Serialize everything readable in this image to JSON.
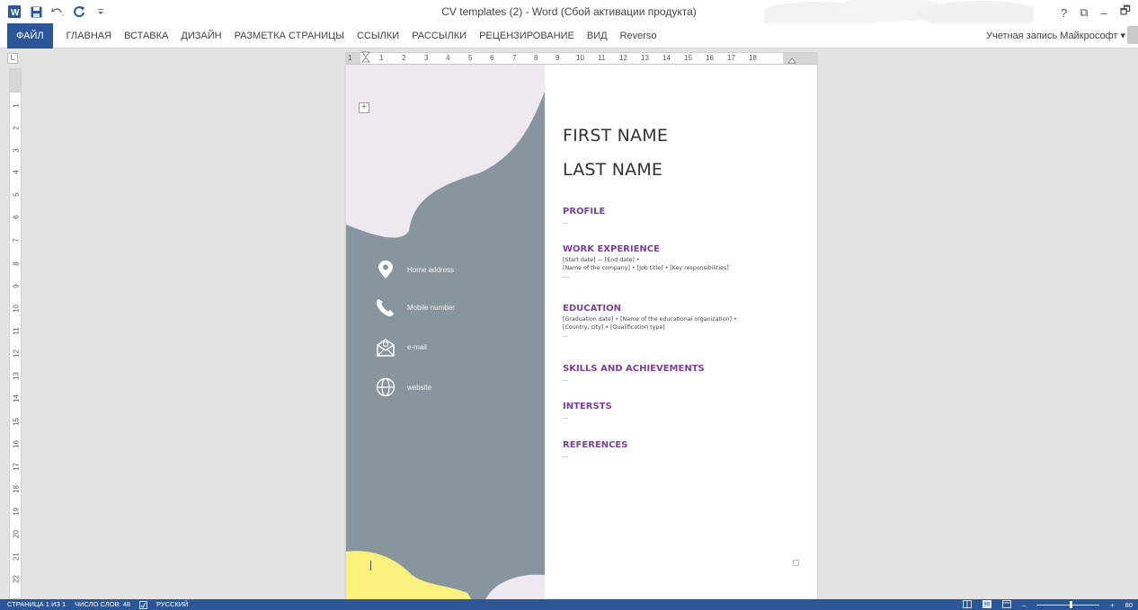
{
  "titlebar": {
    "title": "CV templates (2) - Word (Сбой активации продукта)",
    "help": "?",
    "restore": "⧉",
    "minimize": "–",
    "maximize": "🗗"
  },
  "ribbon": {
    "tabs": [
      "ФАЙЛ",
      "ГЛАВНАЯ",
      "ВСТАВКА",
      "ДИЗАЙН",
      "РАЗМЕТКА СТРАНИЦЫ",
      "ССЫЛКИ",
      "РАССЫЛКИ",
      "РЕЦЕНЗИРОВАНИЕ",
      "ВИД",
      "Reverso"
    ],
    "account": "Учетная запись Майкрософт ▾"
  },
  "ruler": {
    "corner": "L",
    "h_numbers": [
      "1",
      "1",
      "2",
      "3",
      "4",
      "5",
      "6",
      "7",
      "8",
      "9",
      "10",
      "11",
      "12",
      "13",
      "14",
      "15",
      "16",
      "17",
      "18"
    ],
    "v_numbers": [
      "1",
      "2",
      "3",
      "4",
      "5",
      "6",
      "7",
      "8",
      "9",
      "10",
      "11",
      "12",
      "13",
      "14",
      "15",
      "16",
      "17",
      "18",
      "19",
      "20",
      "21",
      "22"
    ]
  },
  "colors": {
    "accent": "#2b579a",
    "sidebar_gray": "#86959e",
    "sidebar_lavender": "#efe8f0",
    "sidebar_yellow": "#fbf07a",
    "heading_purple": "#7b3fa0"
  },
  "cv": {
    "contacts": [
      {
        "icon": "location-pin-icon",
        "label": "Home address"
      },
      {
        "icon": "phone-icon",
        "label": "Mobile number"
      },
      {
        "icon": "email-icon",
        "label": "e-mail"
      },
      {
        "icon": "globe-icon",
        "label": "website"
      }
    ],
    "first_name": "FIRST NAME",
    "last_name": "LAST NAME",
    "sections": [
      {
        "title": "PROFILE",
        "lines": [
          "..."
        ]
      },
      {
        "title": "WORK EXPERIENCE",
        "lines": [
          "[Start date] — [End date] •",
          "[Name of the company] • [Job title] • [Key responsibilities]",
          "...."
        ]
      },
      {
        "title": "EDUCATION",
        "lines": [
          "[Graduation date] • [Name of the educational organization] •",
          "[Country, city] • [Qualification type]",
          "..."
        ]
      },
      {
        "title": "SKILLS AND ACHIEVEMENTS",
        "lines": [
          "..."
        ]
      },
      {
        "title": "INTERSTS",
        "lines": [
          "..."
        ]
      },
      {
        "title": "REFERENCES",
        "lines": [
          "..."
        ]
      }
    ]
  },
  "statusbar": {
    "page": "СТРАНИЦА 1 ИЗ 1",
    "words": "ЧИСЛО СЛОВ: 48",
    "language": "РУССКИЙ",
    "zoom_minus": "–",
    "zoom_plus": "+",
    "zoom_level": "80"
  }
}
